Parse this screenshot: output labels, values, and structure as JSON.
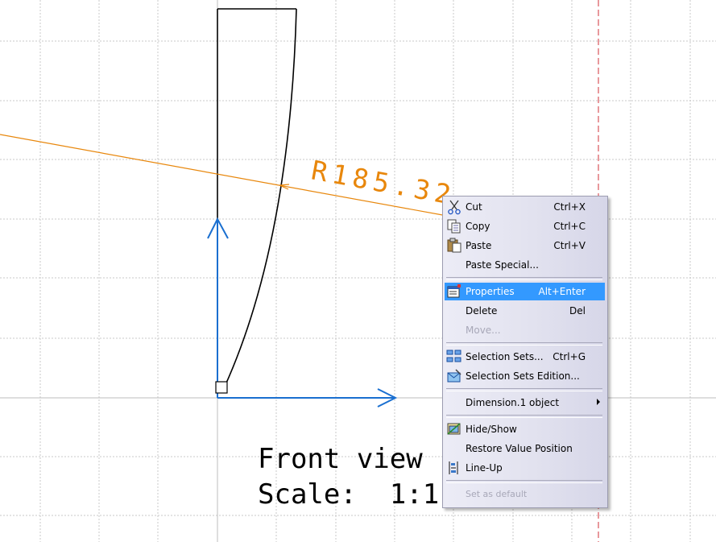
{
  "drawing": {
    "dimension_label": "R185.32",
    "view_title_line1": "Front view",
    "view_title_line2": "Scale:  1:1"
  },
  "context_menu": {
    "items": [
      {
        "label": "Cut",
        "shortcut": "Ctrl+X",
        "icon": "scissors-icon"
      },
      {
        "label": "Copy",
        "shortcut": "Ctrl+C",
        "icon": "copy-icon"
      },
      {
        "label": "Paste",
        "shortcut": "Ctrl+V",
        "icon": "clipboard-icon"
      },
      {
        "label": "Paste Special...",
        "shortcut": ""
      },
      {
        "label": "Properties",
        "shortcut": "Alt+Enter",
        "icon": "properties-icon",
        "selected": true
      },
      {
        "label": "Delete",
        "shortcut": "Del"
      },
      {
        "label": "Move...",
        "shortcut": "",
        "disabled": true
      },
      {
        "label": "Selection Sets...",
        "shortcut": "Ctrl+G",
        "icon": "selection-sets-icon"
      },
      {
        "label": "Selection Sets Edition...",
        "shortcut": "",
        "icon": "selection-sets-edition-icon"
      },
      {
        "label": "Dimension.1 object",
        "shortcut": "",
        "submenu": true
      },
      {
        "label": "Hide/Show",
        "shortcut": "",
        "icon": "hide-show-icon"
      },
      {
        "label": "Restore Value Position",
        "shortcut": ""
      },
      {
        "label": "Line-Up",
        "shortcut": "",
        "icon": "line-up-icon"
      },
      {
        "label": "Set as default",
        "shortcut": "",
        "disabled": true
      }
    ]
  },
  "colors": {
    "dimension": "#e8870c",
    "axis": "#1a6fd0",
    "highlight": "#3399ff",
    "frame_line": "#d0303a"
  }
}
